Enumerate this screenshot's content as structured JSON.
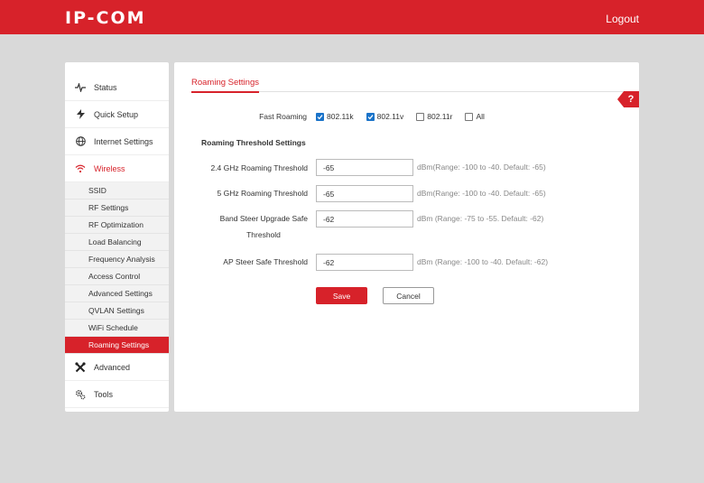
{
  "header": {
    "logo": "IP-COM",
    "logout": "Logout"
  },
  "sidebar": {
    "items": [
      {
        "label": "Status",
        "icon": "pulse-icon"
      },
      {
        "label": "Quick Setup",
        "icon": "lightning-icon"
      },
      {
        "label": "Internet Settings",
        "icon": "globe-icon"
      },
      {
        "label": "Wireless",
        "icon": "wifi-icon"
      },
      {
        "label": "Advanced",
        "icon": "tools-icon"
      },
      {
        "label": "Tools",
        "icon": "gears-icon"
      }
    ],
    "wireless_sub": [
      "SSID",
      "RF Settings",
      "RF Optimization",
      "Load Balancing",
      "Frequency Analysis",
      "Access Control",
      "Advanced Settings",
      "QVLAN Settings",
      "WiFi Schedule",
      "Roaming Settings"
    ],
    "active_sub": "Roaming Settings"
  },
  "main": {
    "tab_title": "Roaming Settings",
    "help": "?",
    "fast_roaming": {
      "label": "Fast Roaming",
      "options": [
        {
          "label": "802.11k",
          "checked": true
        },
        {
          "label": "802.11v",
          "checked": true
        },
        {
          "label": "802.11r",
          "checked": false
        },
        {
          "label": "All",
          "checked": false
        }
      ]
    },
    "section_title": "Roaming Threshold Settings",
    "fields": [
      {
        "label": "2.4 GHz Roaming Threshold",
        "value": "-65",
        "hint": "dBm(Range: -100 to -40. Default: -65)"
      },
      {
        "label": "5 GHz Roaming Threshold",
        "value": "-65",
        "hint": "dBm(Range: -100 to -40. Default: -65)"
      },
      {
        "label_line1": "Band Steer Upgrade Safe",
        "label_line2": "Threshold",
        "value": "-62",
        "hint": "dBm (Range: -75 to -55. Default: -62)"
      },
      {
        "label": "AP Steer Safe Threshold",
        "value": "-62",
        "hint": "dBm (Range: -100 to -40. Default: -62)"
      }
    ],
    "save": "Save",
    "cancel": "Cancel"
  },
  "colors": {
    "brand": "#d7222a",
    "checkbox": "#1a73c9",
    "background": "#d9d9d9"
  }
}
